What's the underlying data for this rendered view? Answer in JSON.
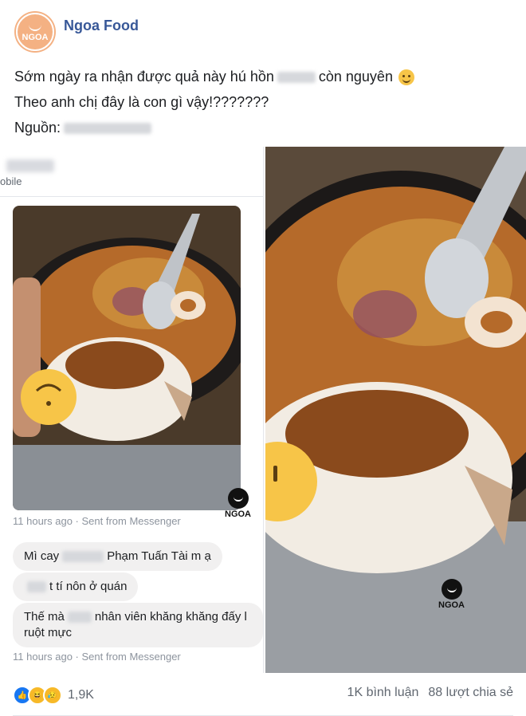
{
  "page": {
    "name": "Ngoa Food",
    "avatar_text": "NGOA"
  },
  "post": {
    "line1_before": "Sớm ngày ra nhận được quả này hú hồn",
    "line1_after": "còn nguyên",
    "line2": "Theo anh chị đây là con gì vậy!???????",
    "line3": "Nguồn:"
  },
  "message_screenshot": {
    "mobile_label": "obile",
    "meta1": "11 hours ago · Sent from Messenger",
    "bubbles": [
      {
        "before": "Mì cay",
        "after": "Phạm Tuấn Tài m ạ"
      },
      {
        "before": "",
        "after": "t tí nôn ở quán"
      },
      {
        "before": "Thế mà",
        "after": "nhân viên khăng khăng đấy l",
        "line2": "ruột mực"
      }
    ],
    "meta2": "11 hours ago · Sent from Messenger"
  },
  "watermark": "NGOA",
  "footer": {
    "reaction_count": "1,9K",
    "comments": "1K bình luận",
    "shares": "88 lượt chia sẻ"
  },
  "icons": [
    "like-reaction-icon",
    "haha-reaction-icon",
    "sad-reaction-icon",
    "smile-emoji-icon"
  ]
}
